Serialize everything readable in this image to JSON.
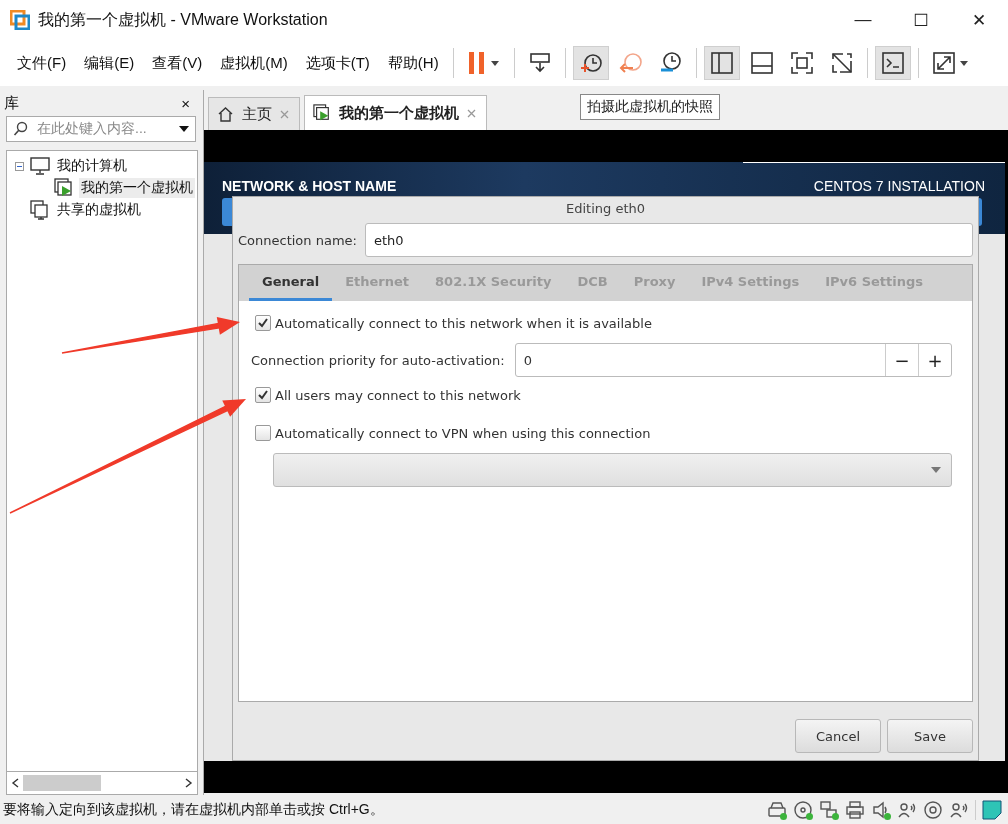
{
  "window": {
    "title": "我的第一个虚拟机 - VMware Workstation",
    "controls": [
      "—",
      "☐",
      "✕"
    ]
  },
  "menu": [
    "文件(F)",
    "编辑(E)",
    "查看(V)",
    "虚拟机(M)",
    "选项卡(T)",
    "帮助(H)"
  ],
  "toolbar": {
    "buttons": [
      {
        "kind": "pause",
        "pressed": false
      },
      {
        "kind": "send-keys",
        "pressed": false
      },
      {
        "kind": "snapshot",
        "pressed": true
      },
      {
        "kind": "revert",
        "pressed": false
      },
      {
        "kind": "manager",
        "pressed": false
      },
      {
        "kind": "library-view",
        "pressed": true
      },
      {
        "kind": "thumbnail-view",
        "pressed": false
      },
      {
        "kind": "fullscreen",
        "pressed": false
      },
      {
        "kind": "unity",
        "pressed": false
      },
      {
        "kind": "console",
        "pressed": true
      },
      {
        "kind": "stretch",
        "pressed": false
      }
    ],
    "tooltip": "拍摄此虚拟机的快照"
  },
  "library": {
    "title": "库",
    "close": "×",
    "search_placeholder": "在此处键入内容...",
    "tree": [
      {
        "label": "我的计算机",
        "kind": "computer",
        "selected": false,
        "expanded": true,
        "children": [
          {
            "label": "我的第一个虚拟机",
            "kind": "vm",
            "selected": true
          }
        ]
      },
      {
        "label": "共享的虚拟机",
        "kind": "shared",
        "selected": false
      }
    ]
  },
  "tabs": [
    {
      "label": "主页",
      "kind": "home",
      "selected": false
    },
    {
      "label": "我的第一个虚拟机",
      "kind": "vm",
      "selected": true
    }
  ],
  "guest": {
    "header_title": "NETWORK & HOST NAME",
    "product": "CENTOS 7 INSTALLATION",
    "dialog": {
      "title": "Editing eth0",
      "connection_name_label": "Connection name:",
      "connection_name": "eth0",
      "tabs": [
        {
          "label": "General",
          "selected": true
        },
        {
          "label": "Ethernet",
          "selected": false
        },
        {
          "label": "802.1X Security",
          "selected": false
        },
        {
          "label": "DCB",
          "selected": false
        },
        {
          "label": "Proxy",
          "selected": false
        },
        {
          "label": "IPv4 Settings",
          "selected": false
        },
        {
          "label": "IPv6 Settings",
          "selected": false
        }
      ],
      "options": [
        {
          "kind": "checkbox",
          "label": "Automatically connect to this network when it is available",
          "checked": true
        },
        {
          "kind": "spin",
          "label": "Connection priority for auto-activation:",
          "value": "0",
          "decrement": "−",
          "increment": "+"
        },
        {
          "kind": "checkbox",
          "label": "All users may connect to this network",
          "checked": true
        },
        {
          "kind": "checkbox",
          "label": "Automatically connect to VPN when using this connection",
          "checked": false
        },
        {
          "kind": "dropdown"
        }
      ],
      "buttons": [
        "Cancel",
        "Save"
      ]
    }
  },
  "annotations": [
    {
      "kind": "arrow"
    },
    {
      "kind": "arrow"
    }
  ],
  "status_bar": {
    "message": "要将输入定向到该虚拟机，请在虚拟机内部单击或按 Ctrl+G。",
    "devices": [
      {
        "kind": "disk",
        "connected": true
      },
      {
        "kind": "cd",
        "connected": true
      },
      {
        "kind": "network",
        "connected": true
      },
      {
        "kind": "printer",
        "connected": false
      },
      {
        "kind": "sound",
        "connected": true
      },
      {
        "kind": "voice",
        "connected": false
      },
      {
        "kind": "camera",
        "connected": false
      },
      {
        "kind": "voice",
        "connected": false
      }
    ]
  }
}
